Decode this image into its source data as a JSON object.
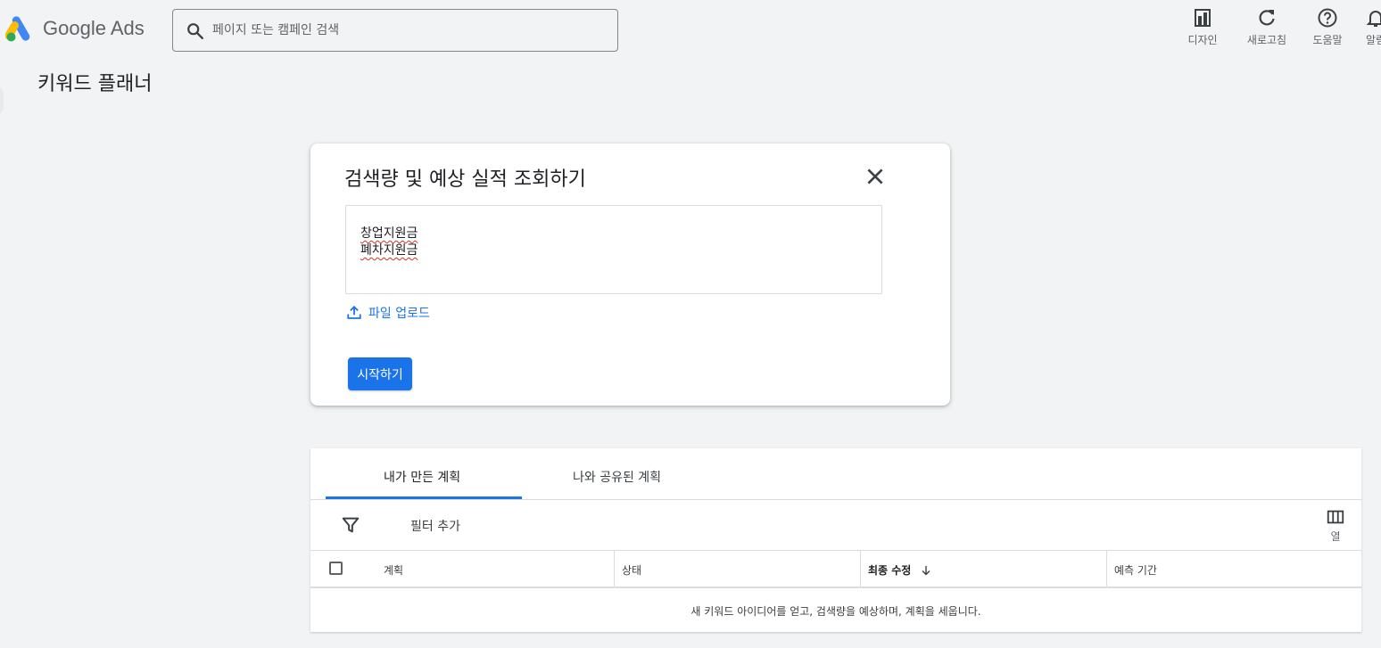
{
  "header": {
    "brand": "Google Ads",
    "search_placeholder": "페이지 또는 캠페인 검색",
    "tools": [
      {
        "label": "디자인",
        "icon": "design-icon"
      },
      {
        "label": "새로고침",
        "icon": "refresh-icon"
      },
      {
        "label": "도움말",
        "icon": "help-icon"
      },
      {
        "label": "알림",
        "icon": "bell-icon"
      }
    ]
  },
  "page": {
    "title": "키워드 플래너"
  },
  "dialog": {
    "title": "검색량 및 예상 실적 조회하기",
    "keywords": [
      "창업지원금",
      "폐차지원금"
    ],
    "upload_label": "파일 업로드",
    "start_label": "시작하기"
  },
  "plans": {
    "tabs": [
      {
        "label": "내가 만든 계획",
        "active": true
      },
      {
        "label": "나와 공유된 계획",
        "active": false
      }
    ],
    "filter_label": "필터 추가",
    "columns_label": "열",
    "columns": [
      "계획",
      "상태",
      "최종 수정",
      "예측 기간"
    ],
    "sorted_column": "최종 수정",
    "empty_message": "새 키워드 아이디어를 얻고, 검색량을 예상하며, 계획을 세웁니다."
  },
  "colors": {
    "accent": "#1a73e8",
    "background": "#f1f3f4",
    "text": "#202124",
    "muted": "#5f6368"
  }
}
